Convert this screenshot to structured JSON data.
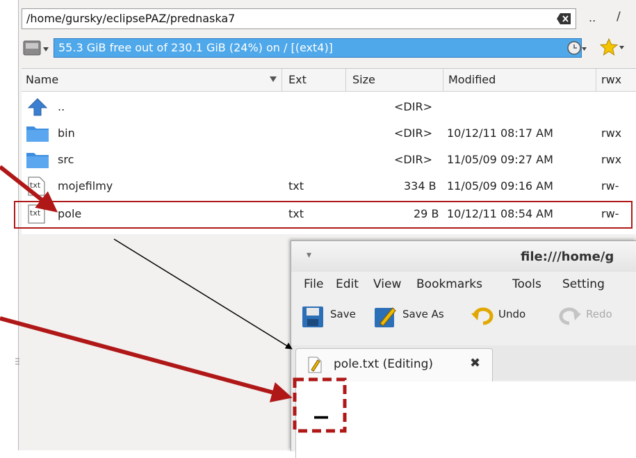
{
  "path": {
    "value": "/home/gursky/eclipsePAZ/prednaska7",
    "dots_label": "..",
    "root_label": "/"
  },
  "drive": {
    "free_text": "55.3 GiB free out of 230.1 GiB (24%) on / [(ext4)]"
  },
  "columns": {
    "name": "Name",
    "ext": "Ext",
    "size": "Size",
    "modified": "Modified",
    "rwx": "rwx"
  },
  "files": [
    {
      "name": "..",
      "ext": "",
      "size": "<DIR>",
      "modified": "",
      "rwx": "",
      "icon": "up-arrow-icon"
    },
    {
      "name": "bin",
      "ext": "",
      "size": "<DIR>",
      "modified": "10/12/11 08:17 AM",
      "rwx": "rwx",
      "icon": "folder-icon"
    },
    {
      "name": "src",
      "ext": "",
      "size": "<DIR>",
      "modified": "11/05/09 09:27 AM",
      "rwx": "rwx",
      "icon": "folder-icon"
    },
    {
      "name": "mojefilmy",
      "ext": "txt",
      "size": "334 B",
      "modified": "11/05/09 09:16 AM",
      "rwx": "rw-",
      "icon": "text-file-icon"
    },
    {
      "name": "pole",
      "ext": "txt",
      "size": "29 B",
      "modified": "10/12/11 08:54 AM",
      "rwx": "rw-",
      "icon": "text-file-icon"
    }
  ],
  "editor": {
    "title": "file:///home/g",
    "menu": [
      "File",
      "Edit",
      "View",
      "Bookmarks",
      "Tools",
      "Setting"
    ],
    "toolbar": {
      "save": "Save",
      "save_as": "Save As",
      "undo": "Undo",
      "redo": "Redo"
    },
    "tab_label": "pole.txt (Editing)",
    "content": "_"
  },
  "colors": {
    "annotation": "#b01818",
    "selection": "#4ea8ea"
  }
}
